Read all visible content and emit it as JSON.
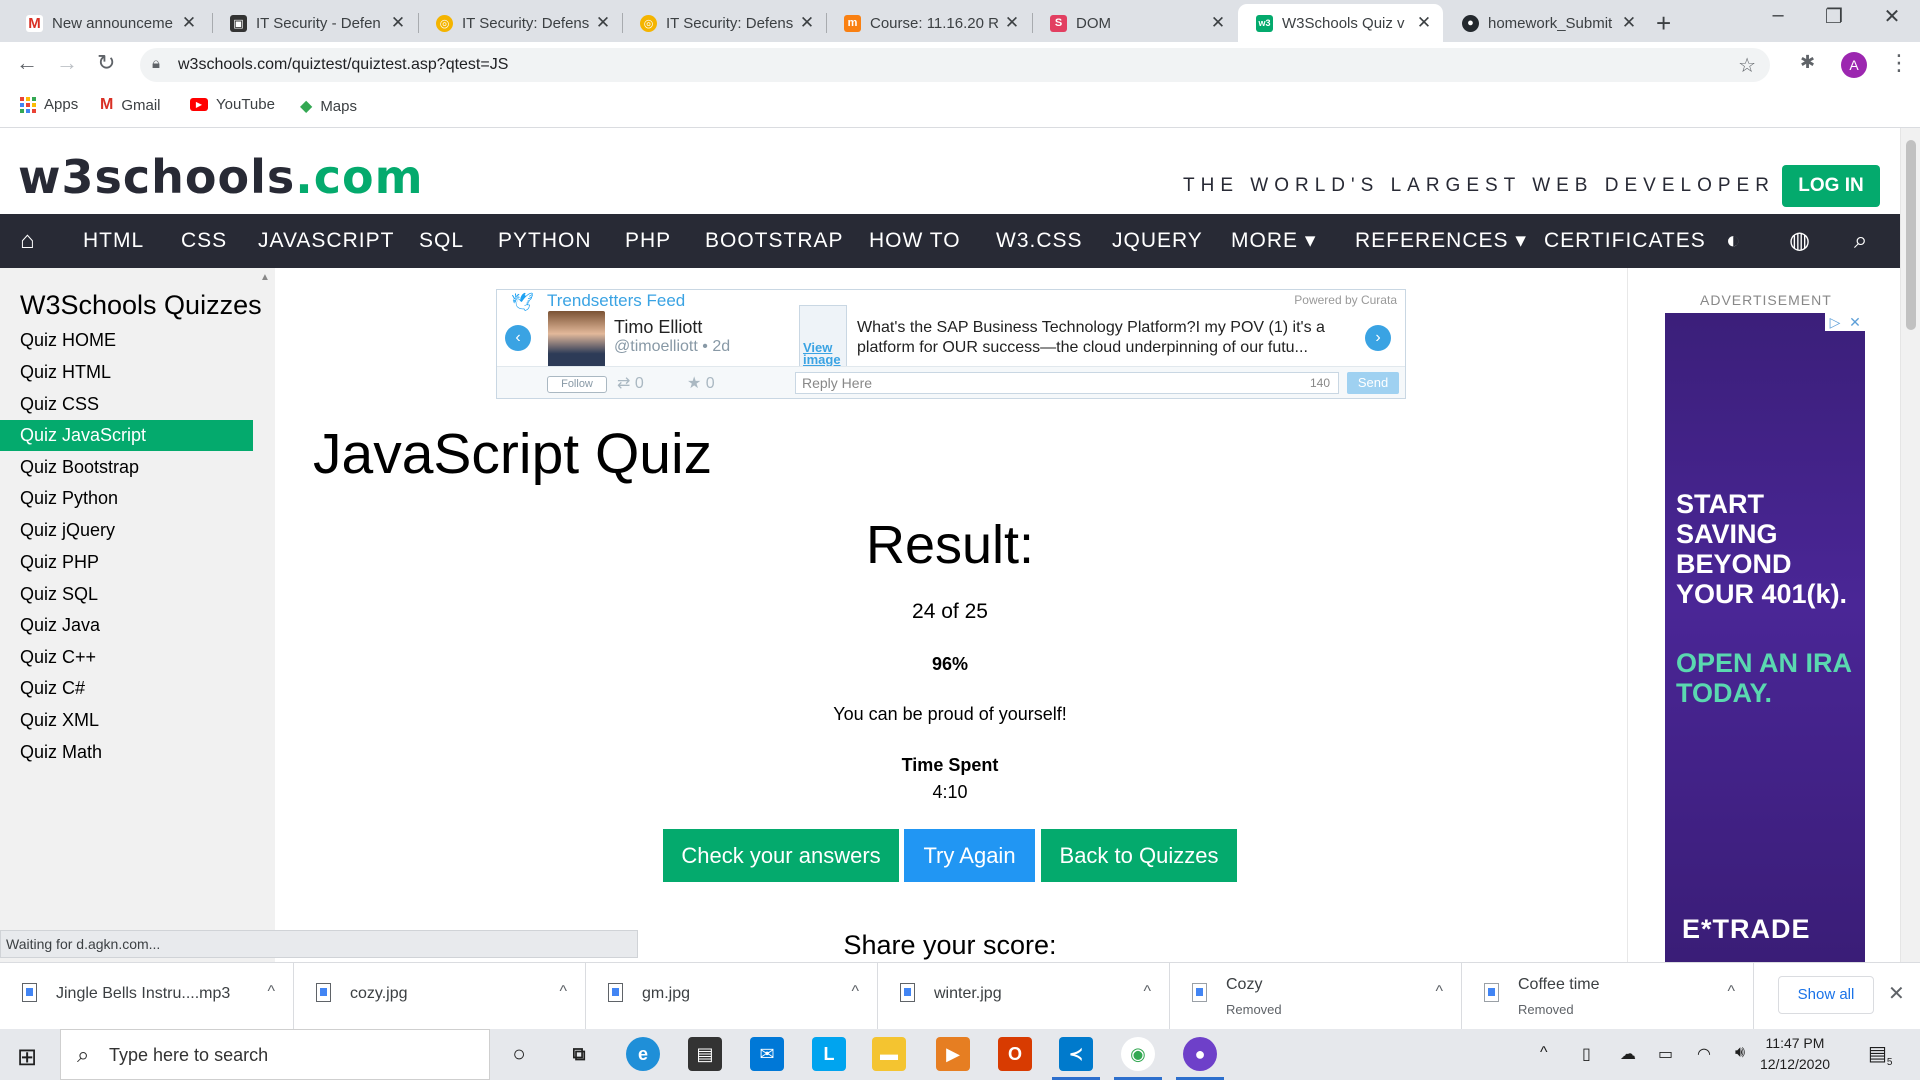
{
  "browser": {
    "tabs": [
      {
        "title": "New announceme",
        "favicon": "gmail-icon",
        "color": "#d93025",
        "glyph": "M"
      },
      {
        "title": "IT Security - Defen",
        "favicon": "canvas-icon",
        "color": "#333333",
        "glyph": "▣"
      },
      {
        "title": "IT Security: Defens",
        "favicon": "coursera-icon",
        "color": "#f4b400",
        "glyph": "◎"
      },
      {
        "title": "IT Security: Defens",
        "favicon": "coursera-icon",
        "color": "#f4b400",
        "glyph": "◎"
      },
      {
        "title": "Course: 11.16.20 R",
        "favicon": "moodle-icon",
        "color": "#f98012",
        "glyph": "m"
      },
      {
        "title": "DOM",
        "favicon": "s-icon",
        "color": "#e23f61",
        "glyph": "S"
      },
      {
        "title": "W3Schools Quiz v",
        "favicon": "w3schools-icon",
        "color": "#04aa6d",
        "glyph": "w3"
      },
      {
        "title": "homework_Submit",
        "favicon": "github-icon",
        "color": "#24292e",
        "glyph": "●"
      }
    ],
    "url": "w3schools.com/quiztest/quiztest.asp?qtest=JS",
    "profile_initial": "A",
    "bookmarks": [
      {
        "label": "Apps"
      },
      {
        "label": "Gmail"
      },
      {
        "label": "YouTube"
      },
      {
        "label": "Maps"
      }
    ]
  },
  "site": {
    "logo_main": "w3schools",
    "logo_dotcom": ".com",
    "tagline": "THE WORLD'S LARGEST WEB DEVELOPER SITE",
    "login": "LOG IN",
    "nav": [
      "HTML",
      "CSS",
      "JAVASCRIPT",
      "SQL",
      "PYTHON",
      "PHP",
      "BOOTSTRAP",
      "HOW TO",
      "W3.CSS",
      "JQUERY",
      "MORE ▾",
      "REFERENCES ▾",
      "CERTIFICATES"
    ],
    "accent": "#04aa6d",
    "nav_bg": "#282a35"
  },
  "sidebar": {
    "title": "W3Schools Quizzes",
    "items": [
      {
        "label": "Quiz HOME"
      },
      {
        "label": "Quiz HTML"
      },
      {
        "label": "Quiz CSS"
      },
      {
        "label": "Quiz JavaScript",
        "active": true
      },
      {
        "label": "Quiz Bootstrap"
      },
      {
        "label": "Quiz Python"
      },
      {
        "label": "Quiz jQuery"
      },
      {
        "label": "Quiz PHP"
      },
      {
        "label": "Quiz SQL"
      },
      {
        "label": "Quiz Java"
      },
      {
        "label": "Quiz C++"
      },
      {
        "label": "Quiz C#"
      },
      {
        "label": "Quiz XML"
      },
      {
        "label": "Quiz Math"
      }
    ]
  },
  "feed": {
    "title": "Trendsetters Feed",
    "powered": "Powered by Curata",
    "author": "Timo Elliott",
    "handle": "@timoelliott • 2d",
    "view_image": "View image",
    "text": "What's the SAP Business Technology Platform?I my POV (1) it's a platform for OUR success—the cloud underpinning of our futu...",
    "follow": "Follow",
    "retweets": "0",
    "favorites": "0",
    "reply_placeholder": "Reply Here",
    "reply_count": "140",
    "send": "Send"
  },
  "quiz": {
    "title": "JavaScript Quiz",
    "result_heading": "Result:",
    "score": "24 of 25",
    "percent": "96%",
    "message": "You can be proud of yourself!",
    "time_label": "Time Spent",
    "time_value": "4:10",
    "buttons": {
      "check": "Check your answers",
      "try_again": "Try Again",
      "back": "Back to Quizzes"
    },
    "share": "Share your score:"
  },
  "ad": {
    "label": "ADVERTISEMENT",
    "headline1": "START SAVING BEYOND YOUR 401(k).",
    "headline2": "OPEN AN IRA TODAY.",
    "brand": "E*TRADE"
  },
  "status": "Waiting for d.agkn.com...",
  "downloads": {
    "items": [
      {
        "name": "Jingle Bells Instru....mp3"
      },
      {
        "name": "cozy.jpg"
      },
      {
        "name": "gm.jpg"
      },
      {
        "name": "winter.jpg"
      },
      {
        "name": "Cozy",
        "sub": "Removed"
      },
      {
        "name": "Coffee time",
        "sub": "Removed"
      }
    ],
    "show_all": "Show all"
  },
  "taskbar": {
    "search_placeholder": "Type here to search",
    "time": "11:47 PM",
    "date": "12/12/2020",
    "notifications": "5"
  }
}
